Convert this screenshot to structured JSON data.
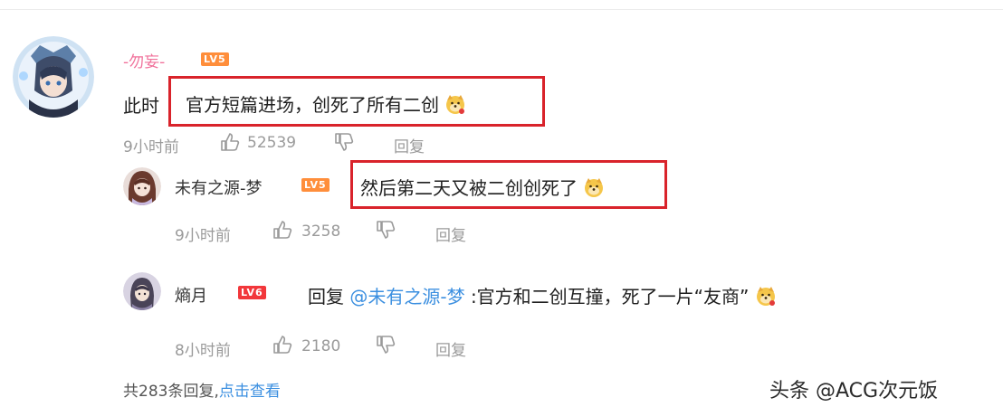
{
  "comment": {
    "username": "-勿妄-",
    "level": "LV5",
    "prefix": "此时",
    "text": "官方短篇进场，创死了所有二创",
    "time": "9小时前",
    "likes": "52539",
    "reply_label": "回复",
    "emoji": "doge-emoji"
  },
  "replies": [
    {
      "username": "未有之源-梦",
      "level": "LV5",
      "text": "然后第二天又被二创创死了",
      "time": "9小时前",
      "likes": "3258",
      "reply_label": "回复",
      "emoji": "doge-emoji"
    },
    {
      "username": "熵月",
      "level": "LV6",
      "reply_prefix": "回复",
      "mention": "@未有之源-梦",
      "text": ":官方和二创互撞，死了一片“友商”",
      "time": "8小时前",
      "likes": "2180",
      "reply_label": "回复",
      "emoji": "doge-emoji"
    }
  ],
  "footer": {
    "count_text": "共283条回复,",
    "link_text": "点击查看"
  },
  "watermark": "头条 @ACG次元饭",
  "colors": {
    "level5": "#ff8e3b",
    "level6": "#f2373b",
    "highlight_box": "#d9232b",
    "link": "#3b8fe0",
    "main_username": "#f0709a"
  }
}
